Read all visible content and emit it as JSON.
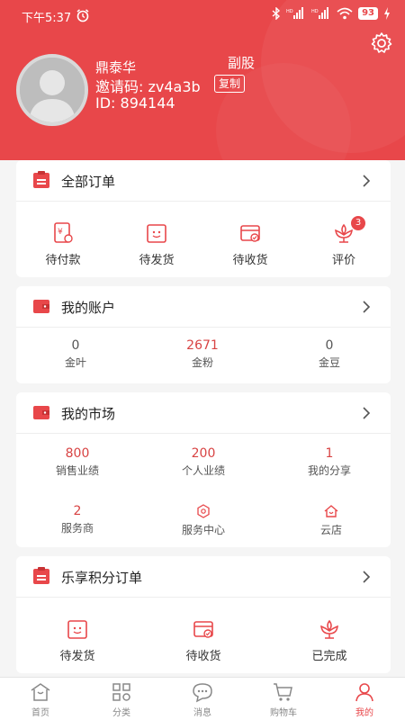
{
  "statusbar": {
    "time": "下午5:37",
    "battery": "93"
  },
  "profile": {
    "name": "鼎泰华",
    "role": "副股",
    "invite_label": "邀请码: zv4a3b",
    "copy_label": "复制",
    "id_label": "ID: 894144"
  },
  "orders": {
    "title": "全部订单",
    "items": [
      {
        "label": "待付款",
        "icon": "pending-payment-icon"
      },
      {
        "label": "待发货",
        "icon": "pending-shipment-icon"
      },
      {
        "label": "待收货",
        "icon": "pending-receipt-icon"
      },
      {
        "label": "评价",
        "icon": "review-icon",
        "badge": "3"
      }
    ]
  },
  "account": {
    "title": "我的账户",
    "items": [
      {
        "value": "0",
        "label": "金叶"
      },
      {
        "value": "2671",
        "label": "金粉"
      },
      {
        "value": "0",
        "label": "金豆"
      }
    ]
  },
  "market": {
    "title": "我的市场",
    "stats": [
      {
        "value": "800",
        "label": "销售业绩"
      },
      {
        "value": "200",
        "label": "个人业绩"
      },
      {
        "value": "1",
        "label": "我的分享"
      }
    ],
    "links": [
      {
        "value": "2",
        "label": "服务商"
      },
      {
        "label": "服务中心",
        "icon": "service-center-icon"
      },
      {
        "label": "云店",
        "icon": "cloud-store-icon"
      }
    ]
  },
  "points_orders": {
    "title": "乐享积分订单",
    "items": [
      {
        "label": "待发货",
        "icon": "pending-shipment-icon"
      },
      {
        "label": "待收货",
        "icon": "pending-receipt-icon"
      },
      {
        "label": "已完成",
        "icon": "completed-icon"
      }
    ]
  },
  "tabbar": {
    "items": [
      {
        "label": "首页"
      },
      {
        "label": "分类"
      },
      {
        "label": "消息"
      },
      {
        "label": "购物车"
      },
      {
        "label": "我的",
        "active": true
      }
    ]
  },
  "colors": {
    "brand": "#e8474a",
    "value_red": "#d84343"
  }
}
